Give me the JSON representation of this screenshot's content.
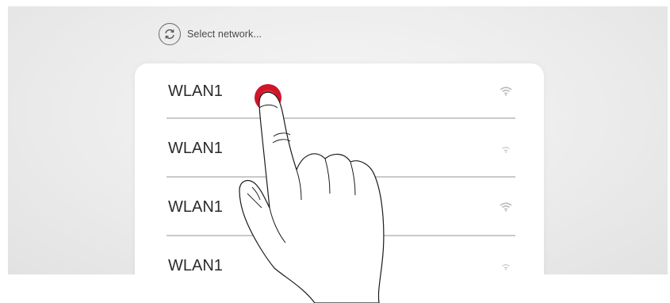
{
  "header": {
    "refresh_icon": "refresh-icon",
    "label": "Select network..."
  },
  "networks": [
    {
      "ssid": "WLAN1",
      "signal_icon": "wifi-strong-icon"
    },
    {
      "ssid": "WLAN1",
      "signal_icon": "wifi-weak-icon"
    },
    {
      "ssid": "WLAN1",
      "signal_icon": "wifi-strong-icon"
    },
    {
      "ssid": "WLAN1",
      "signal_icon": "wifi-weak-icon"
    }
  ],
  "tap_indicator": {
    "color": "#d0142a",
    "icon": "pointing-hand-icon"
  },
  "colors": {
    "divider": "#c9c9c9",
    "text": "#2b2b2b"
  }
}
